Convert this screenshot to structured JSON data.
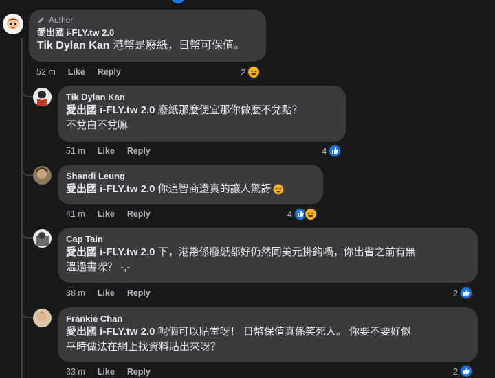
{
  "colors": {
    "background": "#18191a",
    "bubble": "#3a3b3c",
    "muted_text": "#b0b3b8",
    "like_blue": "#1b74e4",
    "haha_yellow": "#f7b125"
  },
  "comments": [
    {
      "author_badge": "Author",
      "name": "愛出國 i-FLY.tw 2.0",
      "mention": "Tik Dylan Kan",
      "body": "港幣是廢紙，日幣可保值。",
      "time": "52 m",
      "like_label": "Like",
      "reply_label": "Reply",
      "reaction_count": "2",
      "reactions": [
        "haha-icon"
      ]
    },
    {
      "name": "Tik Dylan Kan",
      "mention": "愛出國 i-FLY.tw 2.0",
      "body": "廢紙那麼便宜那你做麼不兌點？",
      "body2": "不兌白不兌嘛",
      "time": "51 m",
      "like_label": "Like",
      "reply_label": "Reply",
      "reaction_count": "4",
      "reactions": [
        "like-icon"
      ]
    },
    {
      "name": "Shandi Leung",
      "mention": "愛出國 i-FLY.tw 2.0",
      "body": "你這智商還真的讓人驚訝",
      "time": "41 m",
      "like_label": "Like",
      "reply_label": "Reply",
      "reaction_count": "4",
      "reactions": [
        "like-icon",
        "haha-icon"
      ]
    },
    {
      "name": "Cap Tain",
      "mention": "愛出國 i-FLY.tw 2.0",
      "body": "下，港幣係廢紙都好仍然同美元掛鈎喎，你出省之前有無",
      "body2": "溫過書㗎？ -,-",
      "time": "38 m",
      "like_label": "Like",
      "reply_label": "Reply",
      "reaction_count": "2",
      "reactions": [
        "like-icon"
      ]
    },
    {
      "name": "Frankie Chan",
      "mention": "愛出國 i-FLY.tw 2.0",
      "body": "呢個可以貼堂呀！ 日幣保值真係笑死人。 你要不要好似",
      "body2": "平時做法在網上找資料貼出來呀？",
      "time": "33 m",
      "like_label": "Like",
      "reply_label": "Reply",
      "reaction_count": "2",
      "reactions": [
        "like-icon"
      ]
    }
  ]
}
